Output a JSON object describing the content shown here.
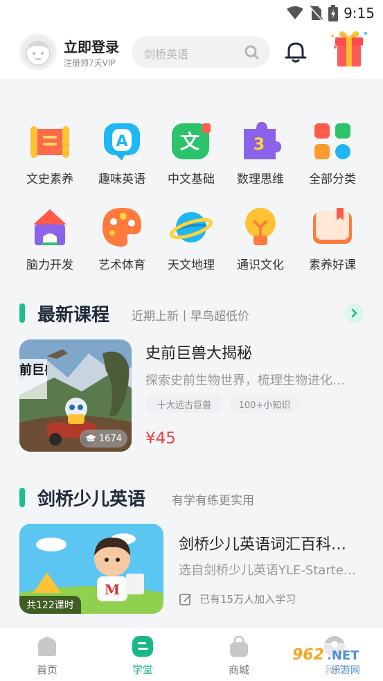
{
  "status_bar": {
    "time": "9:15"
  },
  "header": {
    "login_title": "立即登录",
    "login_subtitle": "注册领7天VIP",
    "search_placeholder": "剑桥英语"
  },
  "categories": [
    {
      "label": "文史素养",
      "icon": "scroll-icon"
    },
    {
      "label": "趣味英语",
      "icon": "letter-a-icon"
    },
    {
      "label": "中文基础",
      "icon": "chinese-character-icon"
    },
    {
      "label": "数理思维",
      "icon": "puzzle-three-icon"
    },
    {
      "label": "全部分类",
      "icon": "grid-dots-icon"
    },
    {
      "label": "脑力开发",
      "icon": "house-blocks-icon"
    },
    {
      "label": "艺术体育",
      "icon": "palette-icon"
    },
    {
      "label": "天文地理",
      "icon": "planet-icon"
    },
    {
      "label": "通识文化",
      "icon": "lightbulb-icon"
    },
    {
      "label": "素养好课",
      "icon": "book-bookmark-icon"
    }
  ],
  "section_new": {
    "title": "最新课程",
    "subtitle": "近期上新丨早鸟超低价"
  },
  "course_1": {
    "title": "史前巨兽大揭秘",
    "description": "探索史前生物世界，梳理生物进化…",
    "tags": [
      "十大远古巨兽",
      "100+小知识"
    ],
    "price": "¥45",
    "learners": "1674",
    "image_text": "前巨兽大揭秘"
  },
  "section_cambridge": {
    "title": "剑桥少儿英语",
    "subtitle": "有学有练更实用"
  },
  "course_2": {
    "title": "剑桥少儿英语词汇百科…",
    "description": "选自剑桥少儿英语YLE-Starte…",
    "join_text": "已有15万人加入学习",
    "lesson_count": "共122课时"
  },
  "bottom_nav": [
    {
      "label": "首页",
      "icon": "home-icon",
      "active": false
    },
    {
      "label": "学堂",
      "icon": "classroom-icon",
      "active": true
    },
    {
      "label": "商城",
      "icon": "shopping-bag-icon",
      "active": false
    },
    {
      "label": "我的",
      "icon": "profile-icon",
      "active": false
    }
  ],
  "watermark": "962.NET 乐游网",
  "colors": {
    "accent": "#1dbf8f",
    "price": "#ee3e3e",
    "title": "#1f2a38"
  }
}
